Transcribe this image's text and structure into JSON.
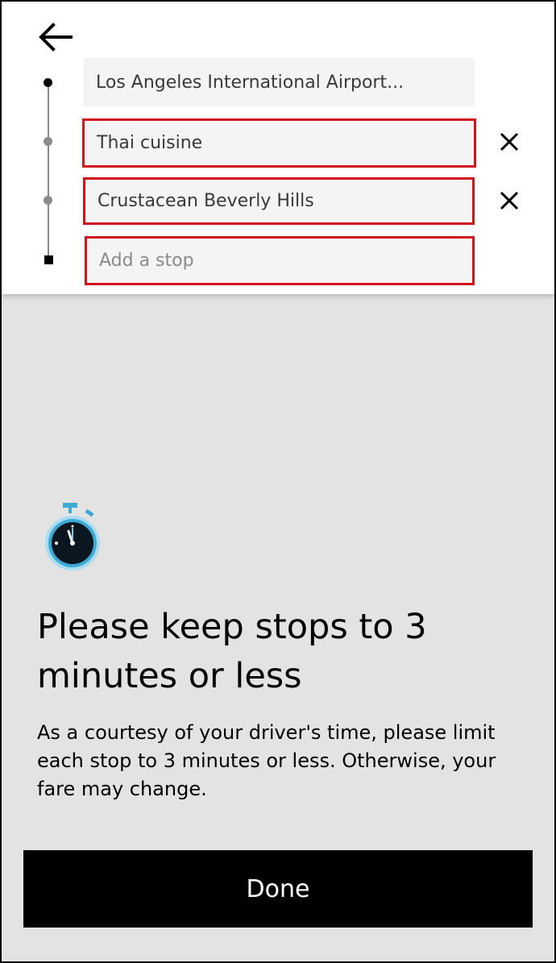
{
  "route": {
    "origin": "Los Angeles International Airport...",
    "stops": [
      {
        "value": "Thai cuisine"
      },
      {
        "value": "Crustacean Beverly Hills"
      }
    ],
    "add_stop_placeholder": "Add a stop"
  },
  "icons": {
    "back": "arrow-left-icon",
    "remove": "close-icon",
    "timer": "stopwatch-icon"
  },
  "message": {
    "headline": "Please keep stops to 3 minutes or less",
    "body": "As a courtesy of your driver's time, please limit each stop to 3 minutes or less. Otherwise, your fare may change."
  },
  "done_label": "Done",
  "colors": {
    "highlight": "#d1141b",
    "button": "#000000",
    "background": "#e3e3e3",
    "timer_accent": "#3fa9d6"
  }
}
